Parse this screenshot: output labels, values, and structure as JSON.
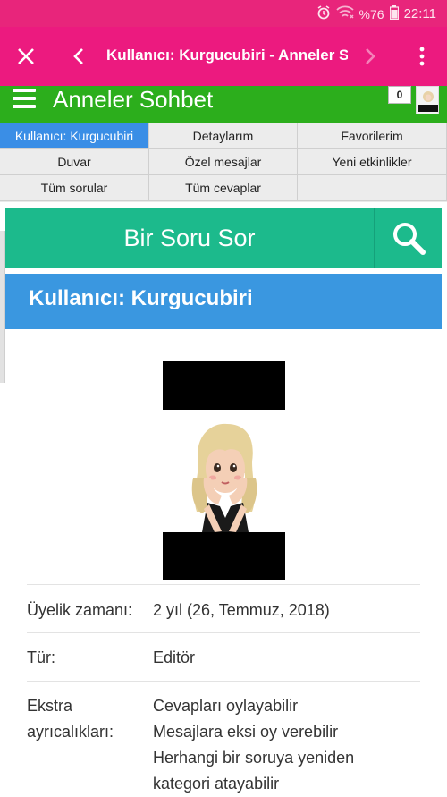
{
  "status_bar": {
    "battery": "%76",
    "time": "22:11"
  },
  "toolbar": {
    "title": "Kullanıcı: Kurgucubiri - Anneler S..."
  },
  "site": {
    "title": "Anneler Sohbet",
    "notification_count": "0"
  },
  "nav": {
    "items": [
      {
        "label": "Kullanıcı: Kurgucubiri",
        "active": true
      },
      {
        "label": "Detaylarım",
        "active": false
      },
      {
        "label": "Favorilerim",
        "active": false
      },
      {
        "label": "Duvar",
        "active": false
      },
      {
        "label": "Özel mesajlar",
        "active": false
      },
      {
        "label": "Yeni etkinlikler",
        "active": false
      },
      {
        "label": "Tüm sorular",
        "active": false
      },
      {
        "label": "Tüm cevaplar",
        "active": false
      }
    ]
  },
  "ask": {
    "label": "Bir Soru Sor"
  },
  "user": {
    "title": "Kullanıcı: Kurgucubiri"
  },
  "info": {
    "membership_label": "Üyelik zamanı:",
    "membership_value": "2 yıl (26, Temmuz, 2018)",
    "type_label": "Tür:",
    "type_value": "Editör",
    "extra_label_1": "Ekstra",
    "extra_label_2": "ayrıcalıkları:",
    "extra_values": [
      "Cevapları oylayabilir",
      "Mesajlara eksi oy verebilir",
      "Herhangi bir soruya yeniden",
      "kategori atayabilir"
    ]
  },
  "colors": {
    "status_bar": "#e8257b",
    "toolbar": "#ec1a7f",
    "header": "#2cae1c",
    "active_tab": "#3a8ee6",
    "ask_bar": "#1cba8c",
    "user_banner": "#3a97e0"
  },
  "icons": [
    "alarm-icon",
    "wifi-icon",
    "battery-icon",
    "close-icon",
    "back-arrow-icon",
    "forward-arrow-icon",
    "more-vert-icon",
    "hamburger-icon",
    "search-icon"
  ]
}
